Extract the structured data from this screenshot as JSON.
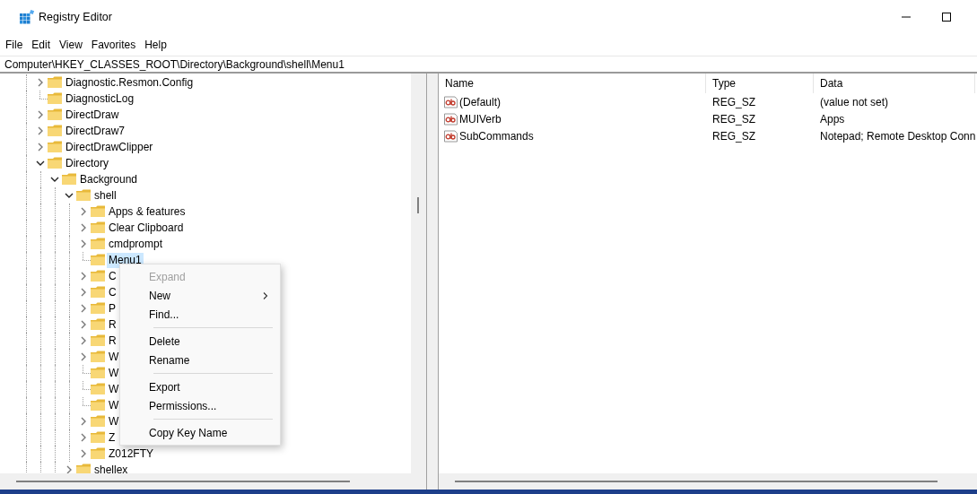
{
  "window": {
    "title": "Registry Editor"
  },
  "menu_bar": [
    "File",
    "Edit",
    "View",
    "Favorites",
    "Help"
  ],
  "address": "Computer\\HKEY_CLASSES_ROOT\\Directory\\Background\\shell\\Menu1",
  "tree": [
    {
      "label": "Diagnostic.Resmon.Config",
      "kind": "node",
      "expanded": false,
      "selected": false
    },
    {
      "label": "DiagnosticLog",
      "kind": "leaf",
      "selected": false
    },
    {
      "label": "DirectDraw",
      "kind": "node",
      "expanded": false,
      "selected": false
    },
    {
      "label": "DirectDraw7",
      "kind": "node",
      "expanded": false,
      "selected": false
    },
    {
      "label": "DirectDrawClipper",
      "kind": "node",
      "expanded": false,
      "selected": false
    },
    {
      "label": "Directory",
      "kind": "node",
      "expanded": true,
      "selected": false,
      "children": [
        {
          "label": "Background",
          "kind": "node",
          "expanded": true,
          "selected": false,
          "children": [
            {
              "label": "shell",
              "kind": "node",
              "expanded": true,
              "selected": false,
              "children": [
                {
                  "label": "Apps & features",
                  "kind": "node",
                  "expanded": false,
                  "selected": false
                },
                {
                  "label": "Clear Clipboard",
                  "kind": "node",
                  "expanded": false,
                  "selected": false
                },
                {
                  "label": "cmdprompt",
                  "kind": "node",
                  "expanded": false,
                  "selected": false
                },
                {
                  "label": "Menu1",
                  "kind": "leaf",
                  "selected": true
                },
                {
                  "label": "C",
                  "kind": "node",
                  "expanded": false,
                  "selected": false
                },
                {
                  "label": "C",
                  "kind": "node",
                  "expanded": false,
                  "selected": false
                },
                {
                  "label": "P",
                  "kind": "node",
                  "expanded": false,
                  "selected": false
                },
                {
                  "label": "R",
                  "kind": "node",
                  "expanded": false,
                  "selected": false
                },
                {
                  "label": "R",
                  "kind": "node",
                  "expanded": false,
                  "selected": false
                },
                {
                  "label": "W",
                  "kind": "node",
                  "expanded": false,
                  "selected": false
                },
                {
                  "label": "W",
                  "kind": "leaf",
                  "selected": false
                },
                {
                  "label": "W",
                  "kind": "leaf",
                  "selected": false
                },
                {
                  "label": "W",
                  "kind": "leaf",
                  "selected": false
                },
                {
                  "label": "W",
                  "kind": "node",
                  "expanded": false,
                  "selected": false
                },
                {
                  "label": "Z",
                  "kind": "node",
                  "expanded": false,
                  "selected": false
                },
                {
                  "label": "Z012FTY",
                  "kind": "node",
                  "expanded": false,
                  "selected": false
                }
              ]
            },
            {
              "label": "shellex",
              "kind": "node",
              "expanded": false,
              "selected": false
            }
          ]
        }
      ]
    }
  ],
  "values_table": {
    "columns": [
      "Name",
      "Type",
      "Data"
    ],
    "rows": [
      {
        "name": "(Default)",
        "type": "REG_SZ",
        "data": "(value not set)"
      },
      {
        "name": "MUIVerb",
        "type": "REG_SZ",
        "data": "Apps"
      },
      {
        "name": "SubCommands",
        "type": "REG_SZ",
        "data": "Notepad; Remote Desktop Conn"
      }
    ]
  },
  "context_menu": [
    {
      "kind": "item",
      "label": "Expand",
      "disabled": true,
      "submenu": false
    },
    {
      "kind": "item",
      "label": "New",
      "disabled": false,
      "submenu": true
    },
    {
      "kind": "item",
      "label": "Find...",
      "disabled": false,
      "submenu": false
    },
    {
      "kind": "separator"
    },
    {
      "kind": "item",
      "label": "Delete",
      "disabled": false,
      "submenu": false
    },
    {
      "kind": "item",
      "label": "Rename",
      "disabled": false,
      "submenu": false
    },
    {
      "kind": "separator"
    },
    {
      "kind": "item",
      "label": "Export",
      "disabled": false,
      "submenu": false
    },
    {
      "kind": "item",
      "label": "Permissions...",
      "disabled": false,
      "submenu": false
    },
    {
      "kind": "separator"
    },
    {
      "kind": "item",
      "label": "Copy Key Name",
      "disabled": false,
      "submenu": false
    }
  ]
}
